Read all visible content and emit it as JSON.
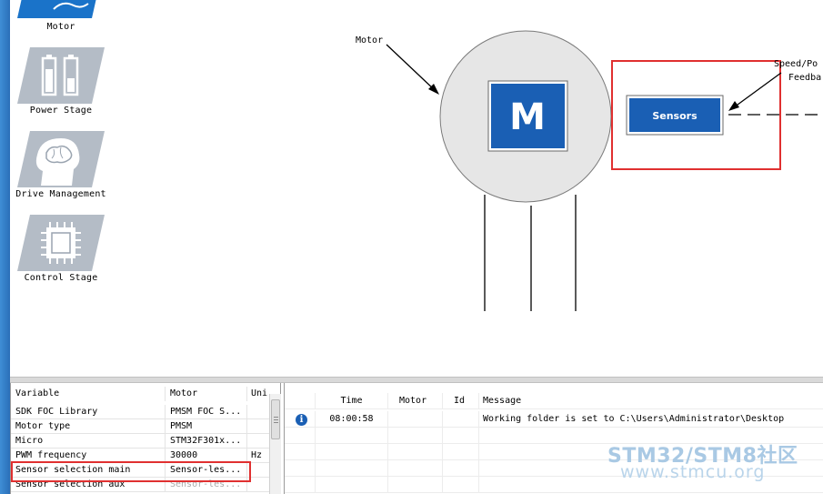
{
  "palette": {
    "items": [
      {
        "label": "Motor",
        "icon": "motor-icon"
      },
      {
        "label": "Power Stage",
        "icon": "battery-icon"
      },
      {
        "label": "Drive Management",
        "icon": "brain-head-icon"
      },
      {
        "label": "Control Stage",
        "icon": "chip-icon"
      }
    ]
  },
  "diagram": {
    "motor_callout": "Motor",
    "motor_symbol": "M",
    "sensors_block": "Sensors",
    "feedback_callout_line1": "Speed/Po",
    "feedback_callout_line2": "Feedba",
    "colors": {
      "accent_blue": "#1a5fb4",
      "highlight_red": "#e03030",
      "motor_body": "#e6e6e6"
    }
  },
  "variables": {
    "headers": [
      "Variable",
      "Motor",
      "Uni"
    ],
    "rows": [
      [
        "SDK FOC Library",
        "PMSM FOC S...",
        ""
      ],
      [
        "Motor type",
        "PMSM",
        ""
      ],
      [
        "Micro",
        "STM32F301x...",
        ""
      ],
      [
        "PWM frequency",
        "30000",
        "Hz"
      ],
      [
        "Sensor selection main",
        "Sensor-les...",
        ""
      ],
      [
        "Sensor selection aux",
        "Sensor-les...",
        ""
      ]
    ]
  },
  "log": {
    "headers": [
      "",
      "Time",
      "Motor",
      "Id",
      "Message"
    ],
    "rows": [
      {
        "icon": "info-icon",
        "time": "08:00:58",
        "motor": "",
        "id": "",
        "message": "Working folder is set to C:\\Users\\Administrator\\Desktop"
      }
    ]
  },
  "watermark": {
    "line1": "STM32/STM8社区",
    "line2": "www.stmcu.org"
  }
}
